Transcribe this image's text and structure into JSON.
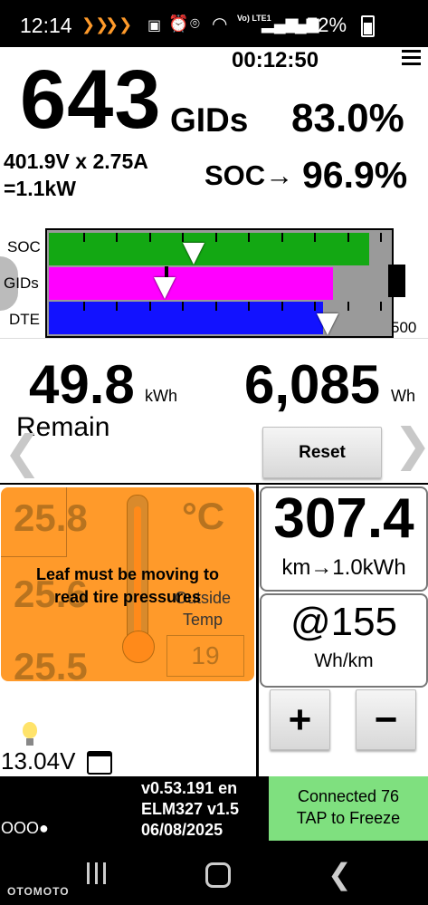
{
  "status_bar": {
    "time": "12:14",
    "battery_percent": "72%",
    "network": "Vo) LTE1",
    "icons": [
      "chevron-heart-icon",
      "chevron-heart-icon",
      "battery-saver-icon",
      "alarm-icon",
      "location-icon",
      "wifi-icon",
      "signal-icon",
      "signal-icon",
      "battery-icon"
    ]
  },
  "header": {
    "timer": "00:12:50",
    "menu_icon": "hamburger-menu-icon"
  },
  "gids": {
    "value": "643",
    "unit": "GIDs",
    "percent": "83.0%"
  },
  "electrical": {
    "line1": "401.9V x 2.75A",
    "line2": "=1.1kW"
  },
  "soc": {
    "label": "SOC→",
    "value": "96.9%"
  },
  "bars": {
    "labels": [
      "SOC",
      "GIDs",
      "DTE"
    ],
    "scale_max_label": "500",
    "colors": {
      "soc": "#13a813",
      "gids": "#ff00ff",
      "dte": "#1212ff",
      "empty": "#9a9a9a",
      "cap": "#000000"
    },
    "soc_fill": 0.97,
    "gids_fill": 0.86,
    "dte_fill": 0.83
  },
  "energy": {
    "remain_value": "49.8",
    "remain_unit": "kWh",
    "remain_label": "Remain",
    "total_value": "6,085",
    "total_unit": "Wh",
    "reset_label": "Reset"
  },
  "temperature": {
    "values": [
      "25.8",
      "25.6",
      "25.5"
    ],
    "unit": "°C",
    "message": "Leaf must be moving to read tire pressures",
    "outside_label": "Outside Temp",
    "outside_value": "19",
    "panel_color": "#ff9a2a"
  },
  "range": {
    "distance": "307.4",
    "rate": "km→1.0kWh",
    "efficiency": "@155",
    "efficiency_unit": "Wh/km",
    "plus_label": "+",
    "minus_label": "−"
  },
  "footer": {
    "voltage": "13.04V",
    "version": "v0.53.191 en",
    "adapter": "ELM327 v1.5",
    "date": "06/08/2025",
    "dots": "OOO●",
    "connection_line1": "Connected 76",
    "connection_line2": "TAP to Freeze",
    "connection_color": "#7fe07f"
  },
  "watermark": "OTOMOTO"
}
